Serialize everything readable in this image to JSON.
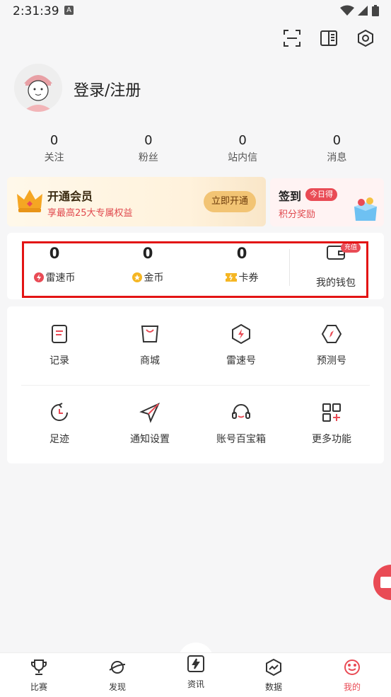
{
  "status_bar": {
    "time": "2:31:39",
    "indicator": "A"
  },
  "header": {
    "actions": [
      {
        "name": "scan-icon"
      },
      {
        "name": "theme-icon"
      },
      {
        "name": "settings-icon"
      }
    ]
  },
  "profile": {
    "login_label": "登录/注册"
  },
  "stats": [
    {
      "value": "0",
      "label": "关注"
    },
    {
      "value": "0",
      "label": "粉丝"
    },
    {
      "value": "0",
      "label": "站内信"
    },
    {
      "value": "0",
      "label": "消息"
    }
  ],
  "vip": {
    "title": "开通会员",
    "subtitle": "享最高25大专属权益",
    "button": "立即开通"
  },
  "sign_in": {
    "title": "签到",
    "tag": "今日得",
    "subtitle": "积分奖励"
  },
  "wallet": {
    "items": [
      {
        "value": "0",
        "label": "雷速币"
      },
      {
        "value": "0",
        "label": "金币"
      },
      {
        "value": "0",
        "label": "卡券"
      }
    ],
    "my_wallet_label": "我的钱包",
    "recharge_badge": "充值"
  },
  "menu": {
    "row1": [
      {
        "label": "记录"
      },
      {
        "label": "商城"
      },
      {
        "label": "雷速号"
      },
      {
        "label": "预测号"
      }
    ],
    "row2": [
      {
        "label": "足迹"
      },
      {
        "label": "通知设置"
      },
      {
        "label": "账号百宝箱"
      },
      {
        "label": "更多功能"
      }
    ]
  },
  "tabbar": {
    "tabs": [
      {
        "label": "比赛"
      },
      {
        "label": "发现"
      },
      {
        "label": "资讯"
      },
      {
        "label": "数据"
      },
      {
        "label": "我的",
        "active": true
      }
    ]
  },
  "colors": {
    "accent": "#e94b55",
    "highlight_border": "#e31414",
    "vip_button": "#f2c474"
  }
}
